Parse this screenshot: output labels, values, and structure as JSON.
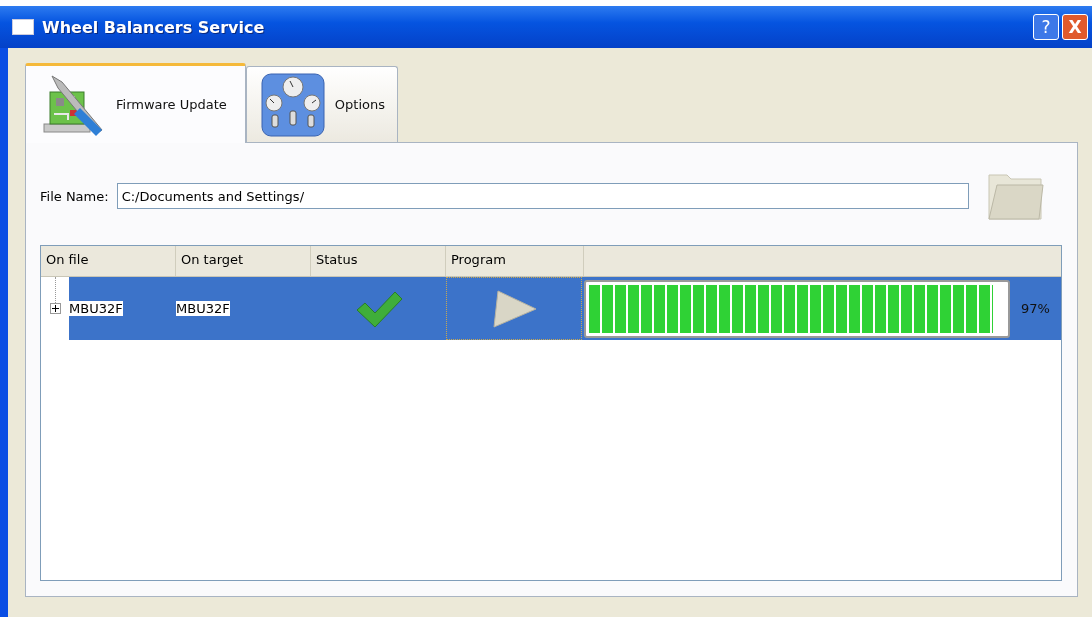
{
  "window": {
    "title": "Wheel Balancers Service",
    "buttons": [
      {
        "kind": "help",
        "label": "?"
      },
      {
        "kind": "close",
        "label": "X"
      }
    ]
  },
  "tabs": [
    {
      "label": "Firmware Update",
      "kind": "firmware",
      "selected": true
    },
    {
      "label": "Options",
      "kind": "options",
      "selected": false
    }
  ],
  "file_name": {
    "label": "File Name:",
    "value": "C:/Documents and Settings/"
  },
  "table": {
    "columns": [
      "On file",
      "On target",
      "Status",
      "Program"
    ],
    "rows": [
      {
        "on_file": "MBU32F",
        "on_target": "MBU32F",
        "completed": true,
        "expanded": false,
        "selected": true,
        "level": 0.97,
        "reading": "97%"
      }
    ]
  }
}
